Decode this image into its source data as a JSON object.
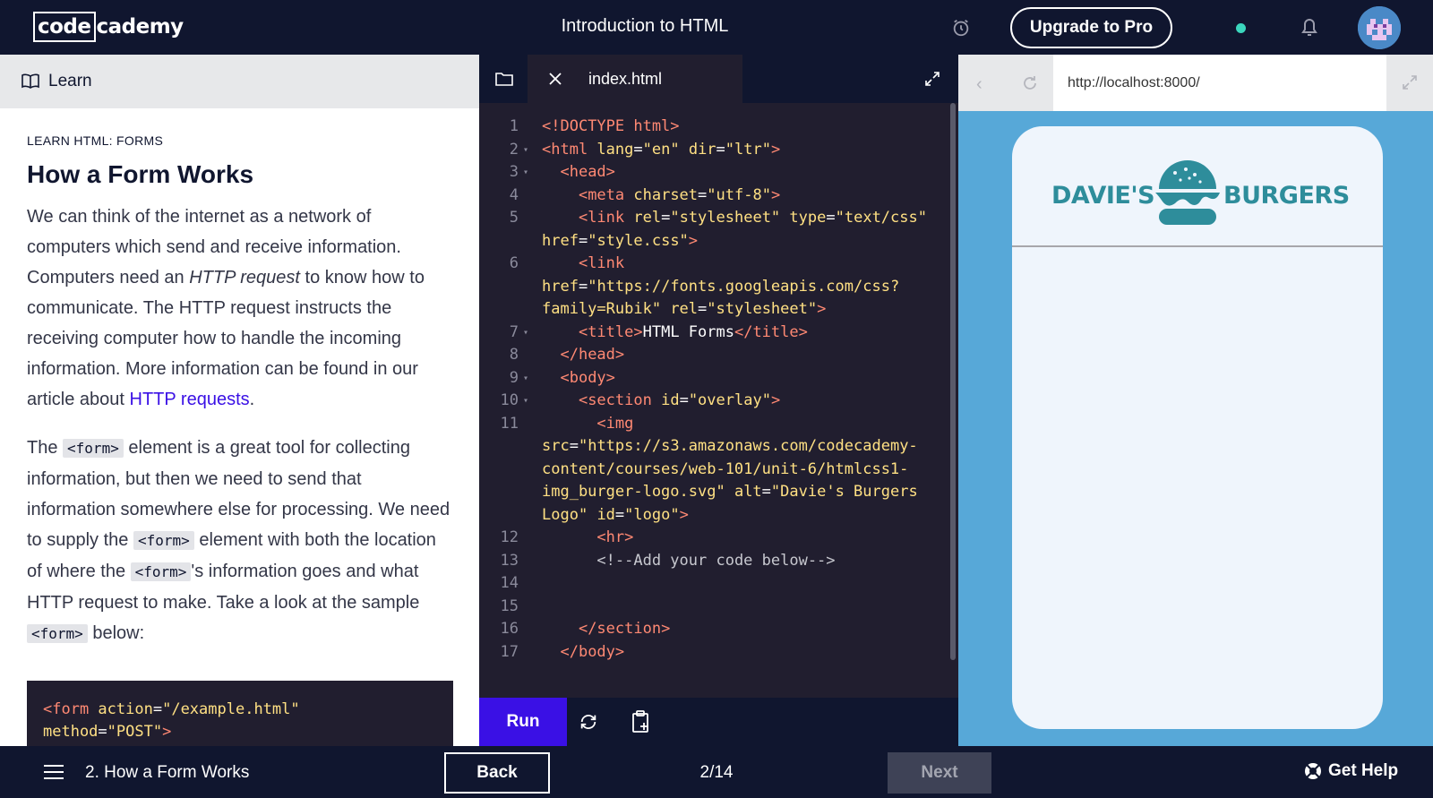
{
  "header": {
    "logo_boxed": "code",
    "logo_rest": "cademy",
    "course_title": "Introduction to HTML",
    "upgrade_label": "Upgrade to Pro"
  },
  "learn": {
    "header_label": "Learn",
    "breadcrumb": "LEARN HTML: FORMS",
    "title": "How a Form Works",
    "p1": {
      "a": "We can think of the internet as a network of computers which send and receive information. Computers need an ",
      "em": "HTTP request",
      "b": " to know how to communicate. The HTTP request instructs the receiving computer how to handle the incoming information. More information can be found in our article about ",
      "link": "HTTP requests",
      "c": "."
    },
    "p2": {
      "a": "The ",
      "code1": "<form>",
      "b": " element is a great tool for collecting information, but then we need to send that information somewhere else for processing. We need to supply the ",
      "code2": "<form>",
      "c": " element with both the location of where the ",
      "code3": "<form>",
      "d": "'s information goes and what HTTP request to make. Take a look at the sample ",
      "code4": "<form>",
      "e": " below:"
    },
    "sample": {
      "l1_tag": "<form ",
      "l1_attr": "action",
      "l1_eq": "=",
      "l1_str": "\"/example.html\"",
      "l2_attr": "method",
      "l2_eq": "=",
      "l2_str": "\"POST\"",
      "l2_tag": ">"
    }
  },
  "editor": {
    "file_name": "index.html",
    "run_label": "Run",
    "lines": [
      {
        "n": "1",
        "fold": false,
        "segs": [
          [
            "tag",
            "<!DOCTYPE html>"
          ]
        ]
      },
      {
        "n": "2",
        "fold": true,
        "segs": [
          [
            "tag",
            "<html "
          ],
          [
            "attr",
            "lang"
          ],
          [
            "plain",
            "="
          ],
          [
            "str",
            "\"en\""
          ],
          [
            "tag",
            " "
          ],
          [
            "attr",
            "dir"
          ],
          [
            "plain",
            "="
          ],
          [
            "str",
            "\"ltr\""
          ],
          [
            "tag",
            ">"
          ]
        ]
      },
      {
        "n": "3",
        "fold": true,
        "segs": [
          [
            "tag",
            "  <head>"
          ]
        ]
      },
      {
        "n": "4",
        "fold": false,
        "segs": [
          [
            "tag",
            "    <meta "
          ],
          [
            "attr",
            "charset"
          ],
          [
            "plain",
            "="
          ],
          [
            "str",
            "\"utf-8\""
          ],
          [
            "tag",
            ">"
          ]
        ]
      },
      {
        "n": "5",
        "fold": false,
        "segs": [
          [
            "tag",
            "    <link "
          ],
          [
            "attr",
            "rel"
          ],
          [
            "plain",
            "="
          ],
          [
            "str",
            "\"stylesheet\""
          ],
          [
            "tag",
            " "
          ],
          [
            "attr",
            "type"
          ],
          [
            "plain",
            "="
          ],
          [
            "str",
            "\"text/css\""
          ],
          [
            "plain",
            "\n"
          ],
          [
            "attr",
            "href"
          ],
          [
            "plain",
            "="
          ],
          [
            "str",
            "\"style.css\""
          ],
          [
            "tag",
            ">"
          ]
        ]
      },
      {
        "n": "6",
        "fold": false,
        "segs": [
          [
            "tag",
            "    <link"
          ],
          [
            "plain",
            "\n"
          ],
          [
            "attr",
            "href"
          ],
          [
            "plain",
            "="
          ],
          [
            "str",
            "\"https://fonts.googleapis.com/css?\nfamily=Rubik\""
          ],
          [
            "tag",
            " "
          ],
          [
            "attr",
            "rel"
          ],
          [
            "plain",
            "="
          ],
          [
            "str",
            "\"stylesheet\""
          ],
          [
            "tag",
            ">"
          ]
        ]
      },
      {
        "n": "7",
        "fold": true,
        "segs": [
          [
            "tag",
            "    <title>"
          ],
          [
            "plain",
            "HTML Forms"
          ],
          [
            "tag",
            "</title>"
          ]
        ]
      },
      {
        "n": "8",
        "fold": false,
        "segs": [
          [
            "tag",
            "  </head>"
          ]
        ]
      },
      {
        "n": "9",
        "fold": true,
        "segs": [
          [
            "tag",
            "  <body>"
          ]
        ]
      },
      {
        "n": "10",
        "fold": true,
        "segs": [
          [
            "tag",
            "    <section "
          ],
          [
            "attr",
            "id"
          ],
          [
            "plain",
            "="
          ],
          [
            "str",
            "\"overlay\""
          ],
          [
            "tag",
            ">"
          ]
        ]
      },
      {
        "n": "11",
        "fold": false,
        "segs": [
          [
            "tag",
            "      <img"
          ],
          [
            "plain",
            "\n"
          ],
          [
            "attr",
            "src"
          ],
          [
            "plain",
            "="
          ],
          [
            "str",
            "\"https://s3.amazonaws.com/codecademy-\ncontent/courses/web-101/unit-6/htmlcss1-\nimg_burger-logo.svg\""
          ],
          [
            "tag",
            " "
          ],
          [
            "attr",
            "alt"
          ],
          [
            "plain",
            "="
          ],
          [
            "str",
            "\"Davie's Burgers\nLogo\""
          ],
          [
            "tag",
            " "
          ],
          [
            "attr",
            "id"
          ],
          [
            "plain",
            "="
          ],
          [
            "str",
            "\"logo\""
          ],
          [
            "tag",
            ">"
          ]
        ]
      },
      {
        "n": "12",
        "fold": false,
        "segs": [
          [
            "tag",
            "      <hr>"
          ]
        ]
      },
      {
        "n": "13",
        "fold": false,
        "segs": [
          [
            "cmt",
            "      <!--Add your code below-->"
          ]
        ]
      },
      {
        "n": "14",
        "fold": false,
        "segs": [
          [
            "plain",
            " "
          ]
        ]
      },
      {
        "n": "15",
        "fold": false,
        "segs": [
          [
            "plain",
            " "
          ]
        ]
      },
      {
        "n": "16",
        "fold": false,
        "segs": [
          [
            "tag",
            "    </section>"
          ]
        ]
      },
      {
        "n": "17",
        "fold": false,
        "segs": [
          [
            "tag",
            "  </body>"
          ]
        ]
      }
    ]
  },
  "browser": {
    "url": "http://localhost:8000/",
    "logo_left": "DAVIE'S",
    "logo_right": "BURGERS"
  },
  "footer": {
    "lesson_title": "2. How a Form Works",
    "back_label": "Back",
    "progress": "2/14",
    "next_label": "Next",
    "help_label": "Get Help"
  },
  "icons": {
    "alarm": "alarm-clock-icon",
    "bell": "bell-icon",
    "book": "book-icon",
    "folder": "folder-icon",
    "close": "close-icon",
    "expand": "expand-icon",
    "reset": "refresh-icon",
    "copy": "copy-to-clipboard-icon",
    "menu": "hamburger-menu-icon",
    "help": "lifebuoy-icon"
  },
  "colors": {
    "brand_dark": "#10162f",
    "accent": "#3a10e5",
    "preview_bg": "#57a8d8",
    "burger_teal": "#2e8d9b"
  }
}
